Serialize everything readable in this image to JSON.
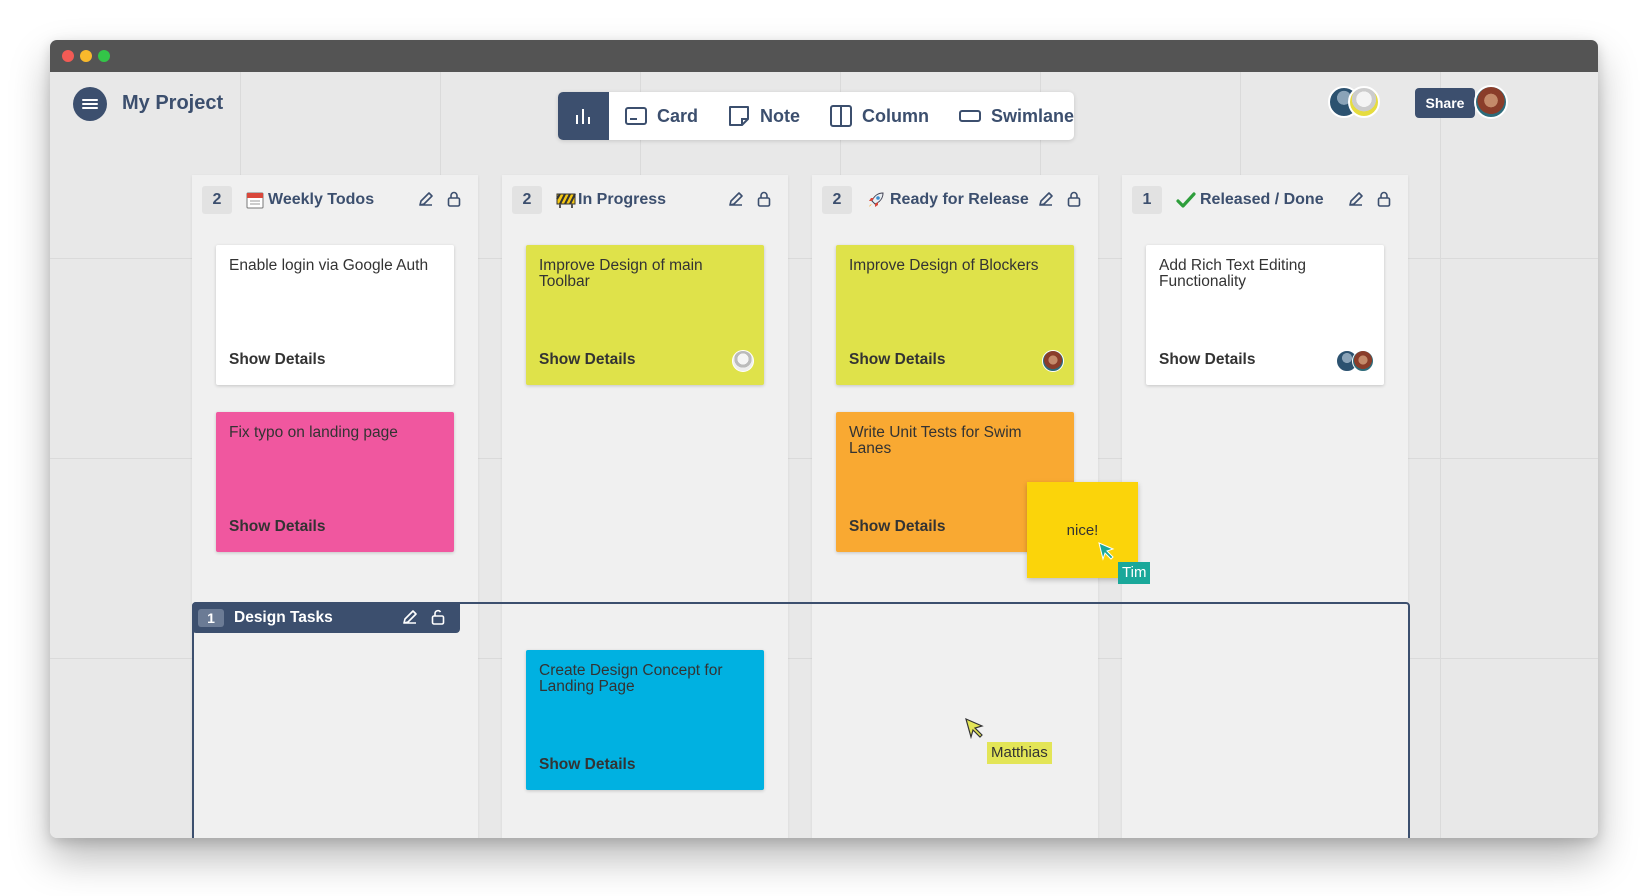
{
  "project": {
    "title": "My Project"
  },
  "toolbar": {
    "items": [
      {
        "label": "Card",
        "icon": "card-icon"
      },
      {
        "label": "Note",
        "icon": "note-icon"
      },
      {
        "label": "Column",
        "icon": "column-icon"
      },
      {
        "label": "Swimlane",
        "icon": "swimlane-icon"
      }
    ],
    "active_icon": "chart-bars-icon"
  },
  "header": {
    "share_label": "Share"
  },
  "columns": [
    {
      "count": "2",
      "title": "Weekly Todos",
      "emoji": "calendar-icon",
      "cards": [
        {
          "title": "Enable login via Google Auth",
          "details": "Show Details",
          "color": "#ffffff"
        },
        {
          "title": "Fix typo on landing page",
          "details": "Show Details",
          "color": "#f0579f"
        }
      ]
    },
    {
      "count": "2",
      "title": "In Progress",
      "emoji": "construction-icon",
      "cards": [
        {
          "title": "Improve Design of main Toolbar",
          "details": "Show Details",
          "color": "#dfe24a"
        }
      ]
    },
    {
      "count": "2",
      "title": "Ready for Release",
      "emoji": "rocket-icon",
      "cards": [
        {
          "title": "Improve Design of Blockers",
          "details": "Show Details",
          "color": "#dfe24a"
        },
        {
          "title": "Write Unit Tests for Swim Lanes",
          "details": "Show Details",
          "color": "#f9a932"
        }
      ]
    },
    {
      "count": "1",
      "title": "Released / Done",
      "emoji": "checkmark-icon",
      "cards": [
        {
          "title": "Add Rich Text Editing Functionality",
          "details": "Show Details",
          "color": "#ffffff"
        }
      ]
    }
  ],
  "swimlane": {
    "count": "1",
    "title": "Design Tasks",
    "cards": [
      {
        "title": "Create Design Concept for Landing Page",
        "details": "Show Details",
        "color": "#00b1e1"
      }
    ]
  },
  "note": {
    "text": "nice!",
    "color": "#fbd40a"
  },
  "cursors": [
    {
      "name": "Tim",
      "color": "#1aa89a"
    },
    {
      "name": "Matthias",
      "color": "#e3e557"
    }
  ],
  "colors": {
    "accent": "#3c4f6e"
  }
}
